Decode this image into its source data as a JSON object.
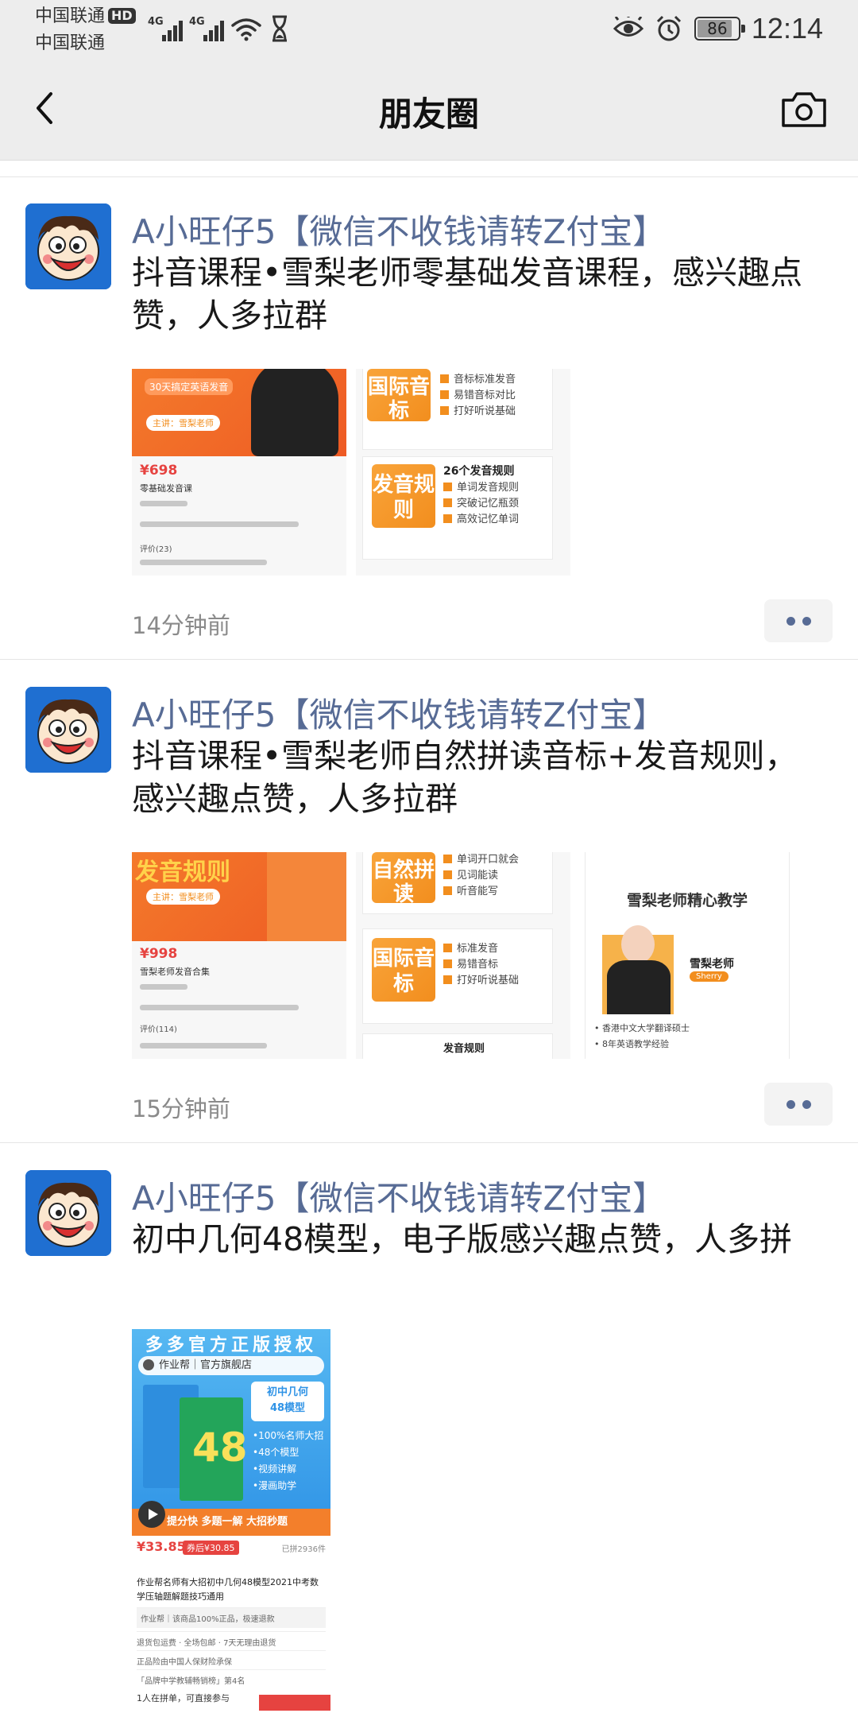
{
  "status_bar": {
    "carrier_1": "中国联通",
    "hd_badge": "HD",
    "carrier_2": "中国联通",
    "network_1": "4G",
    "network_2": "4G",
    "battery_level": "86",
    "time": "12:14"
  },
  "nav": {
    "title": "朋友圈"
  },
  "posts": [
    {
      "name": "A小旺仔5【微信不收钱请转Z付宝】",
      "text": "抖音课程•雪梨老师零基础发音课程，感兴趣点赞，人多拉群",
      "time": "14分钟前",
      "images": {
        "img1": {
          "tag": "30天搞定英语发音",
          "teacher": "主讲：雪梨老师",
          "price": "¥698",
          "title": "零基础发音课",
          "review": "评价(23)"
        },
        "img2": {
          "tag_a": "国际音标",
          "tag_b": "发音规则",
          "count": "26个发音规则",
          "list_a": [
            "音标标准发音",
            "易错音标对比",
            "打好听说基础"
          ],
          "list_b": [
            "单词发音规则",
            "突破记忆瓶颈",
            "高效记忆单词"
          ]
        }
      }
    },
    {
      "name": "A小旺仔5【微信不收钱请转Z付宝】",
      "text": "抖音课程•雪梨老师自然拼读音标+发音规则，感兴趣点赞，人多拉群",
      "time": "15分钟前",
      "images": {
        "img1": {
          "tag": "发音规则",
          "teacher": "主讲：雪梨老师",
          "price": "¥998",
          "title": "雪梨老师发音合集",
          "review": "评价(114)"
        },
        "img2": {
          "tag_a": "自然拼读",
          "tag_b": "国际音标",
          "tag_c": "发音规则",
          "list_a": [
            "单词开口就会",
            "见词能读",
            "听音能写"
          ],
          "list_b": [
            "标准发音",
            "易错音标",
            "打好听说基础"
          ]
        },
        "img3": {
          "headline": "雪梨老师精心教学",
          "name": "雪梨老师",
          "name_en": "Sherry",
          "bullets": [
            "香港中文大学翻译硕士",
            "8年英语教学经验"
          ]
        }
      }
    },
    {
      "name": "A小旺仔5【微信不收钱请转Z付宝】",
      "text": "初中几何48模型，电子版感兴趣点赞，人多拼",
      "images": {
        "product": {
          "banner": "多多官方正版授权",
          "shop": "作业帮｜官方旗舰店",
          "label": "初中几何\n48模型",
          "features": [
            "•100%名师大招",
            "•48个模型",
            "•视频讲解",
            "•漫画助学"
          ],
          "strip": "提分快 多题一解 大招秒题",
          "price": "¥33.85",
          "coupon": "券后¥30.85",
          "sold": "已拼2936件",
          "desc": "作业帮名师有大招初中几何48模型2021中考数学压轴题解题技巧通用",
          "row_1": "作业帮｜该商品100%正品，极速退款",
          "row_2": "退货包运费 · 全场包邮 · 7天无理由退货",
          "row_3": "正品险由中国人保财险承保",
          "row_4": "「品牌中学教辅畅销榜」第4名",
          "bottom": "1人在拼单，可直接参与"
        }
      }
    }
  ],
  "colors": {
    "name_blue": "#576b95",
    "header_bg": "#ededed",
    "time_grey": "#8a8a8a"
  },
  "icons": [
    "back-arrow-icon",
    "camera-icon",
    "more-dots-icon",
    "signal-icon",
    "wifi-icon",
    "hourglass-icon",
    "eye-icon",
    "alarm-icon",
    "battery-icon"
  ]
}
